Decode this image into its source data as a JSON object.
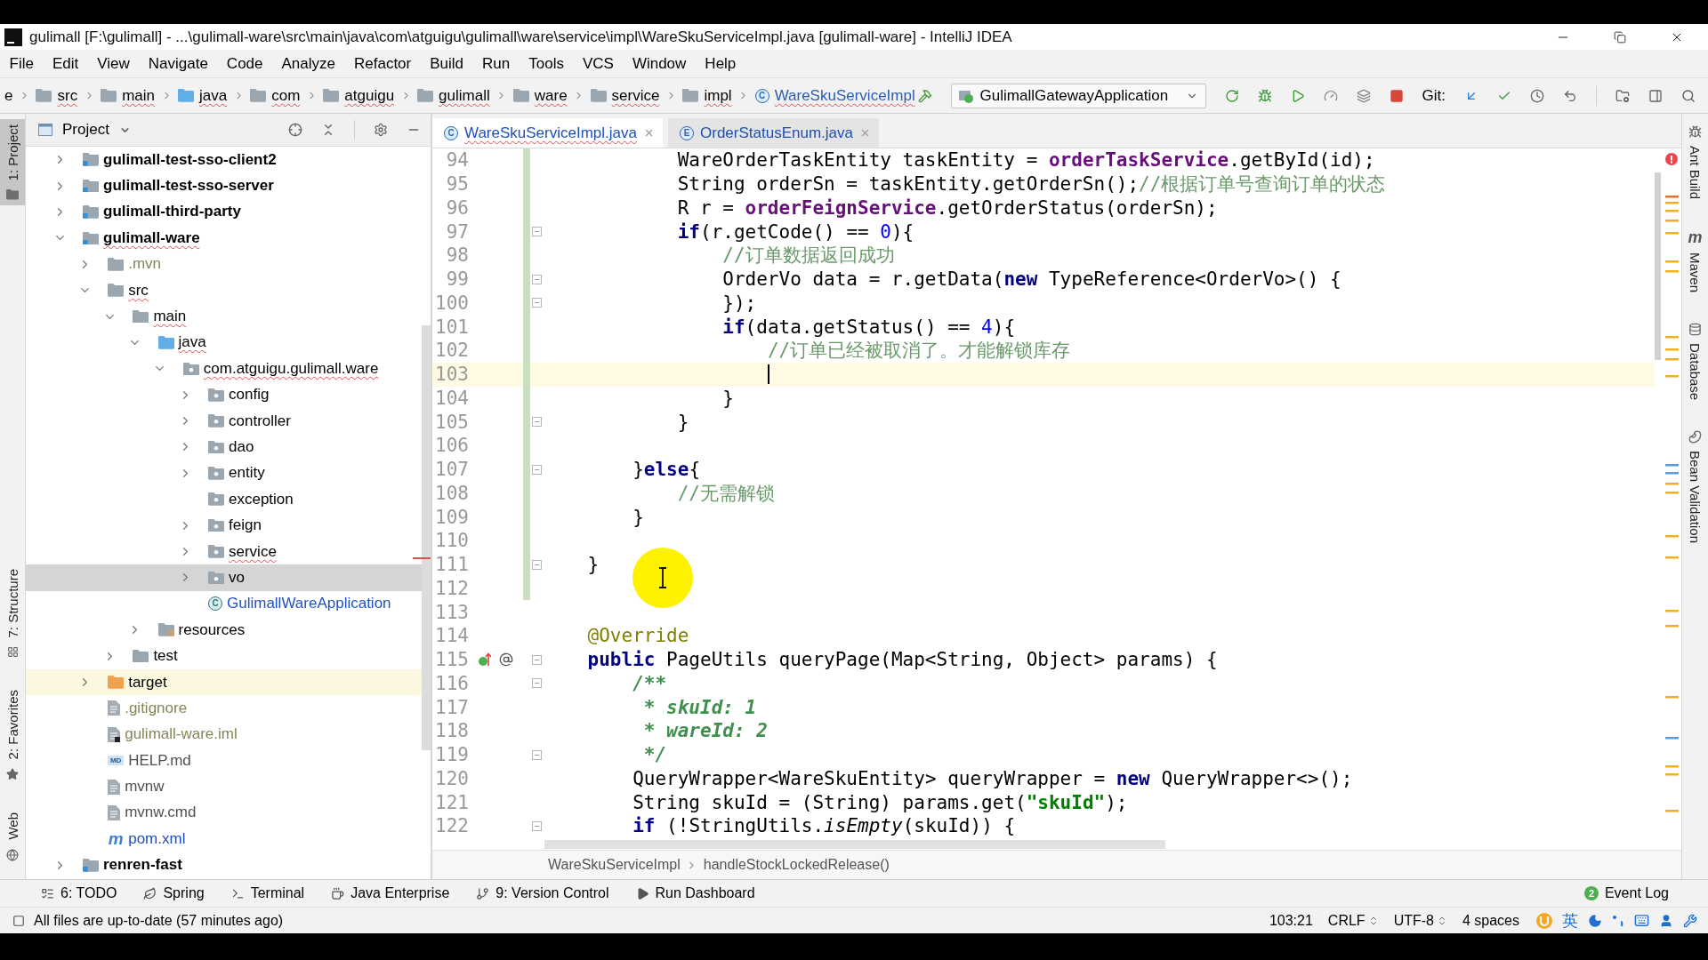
{
  "window": {
    "title": "gulimall [F:\\gulimall] - ...\\gulimall-ware\\src\\main\\java\\com\\atguigu\\gulimall\\ware\\service\\impl\\WareSkuServiceImpl.java [gulimall-ware] - IntelliJ IDEA"
  },
  "menu": [
    "File",
    "Edit",
    "View",
    "Navigate",
    "Code",
    "Analyze",
    "Refactor",
    "Build",
    "Run",
    "Tools",
    "VCS",
    "Window",
    "Help"
  ],
  "navbar": {
    "crumbs": [
      {
        "label": "e",
        "kind": "text",
        "error": false
      },
      {
        "label": "src",
        "kind": "folder",
        "error": true
      },
      {
        "label": "main",
        "kind": "folder",
        "error": true
      },
      {
        "label": "java",
        "kind": "source_folder",
        "error": true
      },
      {
        "label": "com",
        "kind": "folder",
        "error": true
      },
      {
        "label": "atguigu",
        "kind": "folder",
        "error": true
      },
      {
        "label": "gulimall",
        "kind": "folder",
        "error": true
      },
      {
        "label": "ware",
        "kind": "folder",
        "error": true
      },
      {
        "label": "service",
        "kind": "folder",
        "error": true
      },
      {
        "label": "impl",
        "kind": "folder",
        "error": true
      },
      {
        "label": "WareSkuServiceImpl",
        "kind": "class",
        "icon_text": "C",
        "error": true
      }
    ],
    "run_config": "GulimallGatewayApplication",
    "vcs_label": "Git:"
  },
  "left_stripe": {
    "top": [
      {
        "label": "1: Project",
        "kind": "project",
        "selected": true
      }
    ],
    "bottom": [
      {
        "label": "7: Structure",
        "kind": "structure",
        "selected": false
      },
      {
        "label": "2: Favorites",
        "kind": "favorites",
        "selected": false
      },
      {
        "label": "Web",
        "kind": "web",
        "selected": false
      }
    ]
  },
  "project_panel": {
    "title": "Project",
    "tree": [
      {
        "label": "gulimall-test-sso-client2",
        "kind": "module",
        "expanded": false,
        "selected": false,
        "error": false,
        "color": "#000000"
      },
      {
        "label": "gulimall-test-sso-server",
        "kind": "module",
        "expanded": false,
        "selected": false,
        "error": false,
        "color": "#000000"
      },
      {
        "label": "gulimall-third-party",
        "kind": "module",
        "expanded": false,
        "selected": false,
        "error": false,
        "color": "#000000"
      },
      {
        "label": "gulimall-ware",
        "kind": "module",
        "expanded": true,
        "selected": false,
        "error": true,
        "color": "#000000",
        "children": [
          {
            "label": ".mvn",
            "kind": "folder",
            "expanded": false,
            "selected": false,
            "error": false,
            "color": "#85855a"
          },
          {
            "label": "src",
            "kind": "folder",
            "expanded": true,
            "selected": false,
            "error": true,
            "color": "#000000",
            "children": [
              {
                "label": "main",
                "kind": "folder",
                "expanded": true,
                "selected": false,
                "error": true,
                "color": "#000000",
                "children": [
                  {
                    "label": "java",
                    "kind": "source_folder",
                    "expanded": true,
                    "selected": false,
                    "error": true,
                    "color": "#000000",
                    "children": [
                      {
                        "label": "com.atguigu.gulimall.ware",
                        "kind": "package",
                        "expanded": true,
                        "selected": false,
                        "error": true,
                        "color": "#000000",
                        "children": [
                          {
                            "label": "config",
                            "kind": "package",
                            "expanded": false,
                            "selected": false,
                            "error": false,
                            "color": "#000000"
                          },
                          {
                            "label": "controller",
                            "kind": "package",
                            "expanded": false,
                            "selected": false,
                            "error": false,
                            "color": "#000000"
                          },
                          {
                            "label": "dao",
                            "kind": "package",
                            "expanded": false,
                            "selected": false,
                            "error": false,
                            "color": "#000000"
                          },
                          {
                            "label": "entity",
                            "kind": "package",
                            "expanded": false,
                            "selected": false,
                            "error": false,
                            "color": "#000000"
                          },
                          {
                            "label": "exception",
                            "kind": "package",
                            "selected": false,
                            "error": false,
                            "color": "#000000"
                          },
                          {
                            "label": "feign",
                            "kind": "package",
                            "expanded": false,
                            "selected": false,
                            "error": false,
                            "color": "#000000"
                          },
                          {
                            "label": "service",
                            "kind": "package",
                            "expanded": false,
                            "selected": false,
                            "error": true,
                            "color": "#000000"
                          },
                          {
                            "label": "vo",
                            "kind": "package",
                            "expanded": false,
                            "selected": true,
                            "error": false,
                            "color": "#000000"
                          },
                          {
                            "label": "GulimallWareApplication",
                            "kind": "spring_class",
                            "icon_text": "C",
                            "selected": false,
                            "error": false,
                            "color": "#2150c8"
                          }
                        ]
                      }
                    ]
                  },
                  {
                    "label": "resources",
                    "kind": "resource_folder",
                    "expanded": false,
                    "selected": false,
                    "error": false,
                    "color": "#000000"
                  }
                ]
              },
              {
                "label": "test",
                "kind": "folder",
                "expanded": false,
                "selected": false,
                "error": false,
                "color": "#000000"
              }
            ]
          },
          {
            "label": "target",
            "kind": "excluded_folder",
            "expanded": false,
            "selected": false,
            "error": false,
            "color": "#000000"
          },
          {
            "label": ".gitignore",
            "kind": "file",
            "selected": false,
            "error": false,
            "color": "#85855a"
          },
          {
            "label": "gulimall-ware.iml",
            "kind": "iml_file",
            "selected": false,
            "error": false,
            "color": "#85855a"
          },
          {
            "label": "HELP.md",
            "kind": "markdown",
            "icon_text": "MD",
            "selected": false,
            "error": false,
            "color": "#505050"
          },
          {
            "label": "mvnw",
            "kind": "file",
            "selected": false,
            "error": false,
            "color": "#505050"
          },
          {
            "label": "mvnw.cmd",
            "kind": "file",
            "selected": false,
            "error": false,
            "color": "#505050"
          },
          {
            "label": "pom.xml",
            "kind": "maven",
            "icon_text": "m",
            "selected": false,
            "error": false,
            "color": "#1f4fb5"
          }
        ]
      },
      {
        "label": "renren-fast",
        "kind": "module",
        "expanded": false,
        "selected": false,
        "error": false,
        "color": "#000000"
      }
    ]
  },
  "editor": {
    "tabs": [
      {
        "label": "WareSkuServiceImpl.java",
        "kind": "class",
        "icon_text": "C",
        "selected": true,
        "error": true
      },
      {
        "label": "OrderStatusEnum.java",
        "kind": "enum",
        "icon_text": "E",
        "selected": false,
        "error": false
      }
    ],
    "lines": [
      {
        "number": "94",
        "current": false,
        "fold": false,
        "changed": true,
        "tokens": [
          {
            "text": "            WareOrderTaskEntity taskEntity = ",
            "kind": "plain"
          },
          {
            "text": "orderTaskService",
            "kind": "field"
          },
          {
            "text": ".getById(id);",
            "kind": "plain"
          }
        ]
      },
      {
        "number": "95",
        "current": false,
        "fold": false,
        "changed": true,
        "tokens": [
          {
            "text": "            String orderSn = taskEntity.getOrderSn();",
            "kind": "plain"
          },
          {
            "text": "//根据订单号查询订单的状态",
            "kind": "comment"
          }
        ]
      },
      {
        "number": "96",
        "current": false,
        "fold": false,
        "changed": true,
        "tokens": [
          {
            "text": "            R r = ",
            "kind": "plain"
          },
          {
            "text": "orderFeignService",
            "kind": "field"
          },
          {
            "text": ".getOrderStatus(orderSn);",
            "kind": "plain"
          }
        ]
      },
      {
        "number": "97",
        "current": false,
        "fold": true,
        "changed": true,
        "tokens": [
          {
            "text": "            if",
            "kind": "keyword"
          },
          {
            "text": "(r.getCode() == ",
            "kind": "plain"
          },
          {
            "text": "0",
            "kind": "number"
          },
          {
            "text": "){",
            "kind": "plain"
          }
        ]
      },
      {
        "number": "98",
        "current": false,
        "fold": false,
        "changed": true,
        "tokens": [
          {
            "text": "                //订单数据返回成功",
            "kind": "comment"
          }
        ]
      },
      {
        "number": "99",
        "current": false,
        "fold": true,
        "changed": true,
        "tokens": [
          {
            "text": "                OrderVo data = r.getData(",
            "kind": "plain"
          },
          {
            "text": "new",
            "kind": "keyword"
          },
          {
            "text": " TypeReference<OrderVo>() {",
            "kind": "plain"
          }
        ]
      },
      {
        "number": "100",
        "current": false,
        "fold": true,
        "changed": true,
        "tokens": [
          {
            "text": "                });",
            "kind": "plain"
          }
        ]
      },
      {
        "number": "101",
        "current": false,
        "fold": false,
        "changed": true,
        "tokens": [
          {
            "text": "                if",
            "kind": "keyword"
          },
          {
            "text": "(data.getStatus() == ",
            "kind": "plain"
          },
          {
            "text": "4",
            "kind": "number"
          },
          {
            "text": "){",
            "kind": "plain"
          }
        ]
      },
      {
        "number": "102",
        "current": false,
        "fold": false,
        "changed": true,
        "tokens": [
          {
            "text": "                    //订单已经被取消了。才能解锁库存",
            "kind": "comment"
          }
        ]
      },
      {
        "number": "103",
        "current": true,
        "fold": false,
        "changed": true
      },
      {
        "number": "104",
        "current": false,
        "fold": false,
        "changed": true,
        "tokens": [
          {
            "text": "                }",
            "kind": "plain"
          }
        ]
      },
      {
        "number": "105",
        "current": false,
        "fold": true,
        "changed": true,
        "tokens": [
          {
            "text": "            }",
            "kind": "plain"
          }
        ]
      },
      {
        "number": "106",
        "current": false,
        "fold": false,
        "changed": true
      },
      {
        "number": "107",
        "current": false,
        "fold": true,
        "changed": true,
        "tokens": [
          {
            "text": "        }",
            "kind": "plain"
          },
          {
            "text": "else",
            "kind": "keyword"
          },
          {
            "text": "{",
            "kind": "plain"
          }
        ]
      },
      {
        "number": "108",
        "current": false,
        "fold": false,
        "changed": true,
        "tokens": [
          {
            "text": "            //无需解锁",
            "kind": "comment"
          }
        ]
      },
      {
        "number": "109",
        "current": false,
        "fold": false,
        "changed": true,
        "tokens": [
          {
            "text": "        }",
            "kind": "plain"
          }
        ]
      },
      {
        "number": "110",
        "current": false,
        "fold": false,
        "changed": true
      },
      {
        "number": "111",
        "current": false,
        "fold": true,
        "changed": true,
        "tokens": [
          {
            "text": "    }",
            "kind": "plain"
          }
        ]
      },
      {
        "number": "112",
        "current": false,
        "fold": false,
        "changed": true
      },
      {
        "number": "113",
        "current": false,
        "fold": false,
        "changed": false
      },
      {
        "number": "114",
        "current": false,
        "fold": false,
        "changed": false,
        "tokens": [
          {
            "text": "    @Override",
            "kind": "annotation"
          }
        ]
      },
      {
        "number": "115",
        "current": false,
        "fold": true,
        "changed": false,
        "markers": [
          {
            "kind": "override"
          },
          {
            "kind": "annotation"
          }
        ],
        "tokens": [
          {
            "text": "    public",
            "kind": "keyword"
          },
          {
            "text": " PageUtils queryPage(Map<String, Object> params) {",
            "kind": "plain"
          }
        ]
      },
      {
        "number": "116",
        "current": false,
        "fold": true,
        "changed": false,
        "tokens": [
          {
            "text": "        /**",
            "kind": "doc"
          }
        ]
      },
      {
        "number": "117",
        "current": false,
        "fold": false,
        "changed": false,
        "tokens": [
          {
            "text": "         * skuId: 1",
            "kind": "doc"
          }
        ]
      },
      {
        "number": "118",
        "current": false,
        "fold": false,
        "changed": false,
        "tokens": [
          {
            "text": "         * wareId: 2",
            "kind": "doc"
          }
        ]
      },
      {
        "number": "119",
        "current": false,
        "fold": true,
        "changed": false,
        "tokens": [
          {
            "text": "         */",
            "kind": "doc"
          }
        ]
      },
      {
        "number": "120",
        "current": false,
        "fold": false,
        "changed": false,
        "tokens": [
          {
            "text": "        QueryWrapper<WareSkuEntity> queryWrapper = ",
            "kind": "plain"
          },
          {
            "text": "new",
            "kind": "keyword"
          },
          {
            "text": " QueryWrapper<>();",
            "kind": "plain"
          }
        ]
      },
      {
        "number": "121",
        "current": false,
        "fold": false,
        "changed": false,
        "tokens": [
          {
            "text": "        String skuId = (String) params.get(",
            "kind": "plain"
          },
          {
            "text": "\"skuId\"",
            "kind": "string"
          },
          {
            "text": ");",
            "kind": "plain"
          }
        ]
      },
      {
        "number": "122",
        "current": false,
        "fold": true,
        "changed": false,
        "tokens": [
          {
            "text": "        if",
            "kind": "keyword"
          },
          {
            "text": " (!StringUtils.",
            "kind": "plain"
          },
          {
            "text": "isEmpty",
            "kind": "static"
          },
          {
            "text": "(skuId)) {",
            "kind": "plain"
          }
        ]
      }
    ],
    "breadcrumbs": [
      "WareSkuServiceImpl",
      "handleStockLockedRelease()"
    ]
  },
  "right_stripe": [
    {
      "label": "Ant Build",
      "kind": "ant"
    },
    {
      "label": "Maven",
      "kind": "maven",
      "icon_text": "m"
    },
    {
      "label": "Database",
      "kind": "database"
    },
    {
      "label": "Bean Validation",
      "kind": "bean_validation"
    }
  ],
  "tool_tabs": [
    {
      "label": "6: TODO",
      "kind": "todo"
    },
    {
      "label": "Spring",
      "kind": "spring"
    },
    {
      "label": "Terminal",
      "kind": "terminal"
    },
    {
      "label": "Java Enterprise",
      "kind": "java_enterprise"
    },
    {
      "label": "9: Version Control",
      "kind": "version_control"
    },
    {
      "label": "Run Dashboard",
      "kind": "run_dashboard"
    }
  ],
  "event_log": {
    "label": "Event Log",
    "badge": "2"
  },
  "status_bar": {
    "message": "All files are up-to-date (57 minutes ago)",
    "position": "103:21",
    "line_ending": "CRLF",
    "encoding": "UTF-8",
    "indent": "4 spaces",
    "ime_mode": "英"
  }
}
